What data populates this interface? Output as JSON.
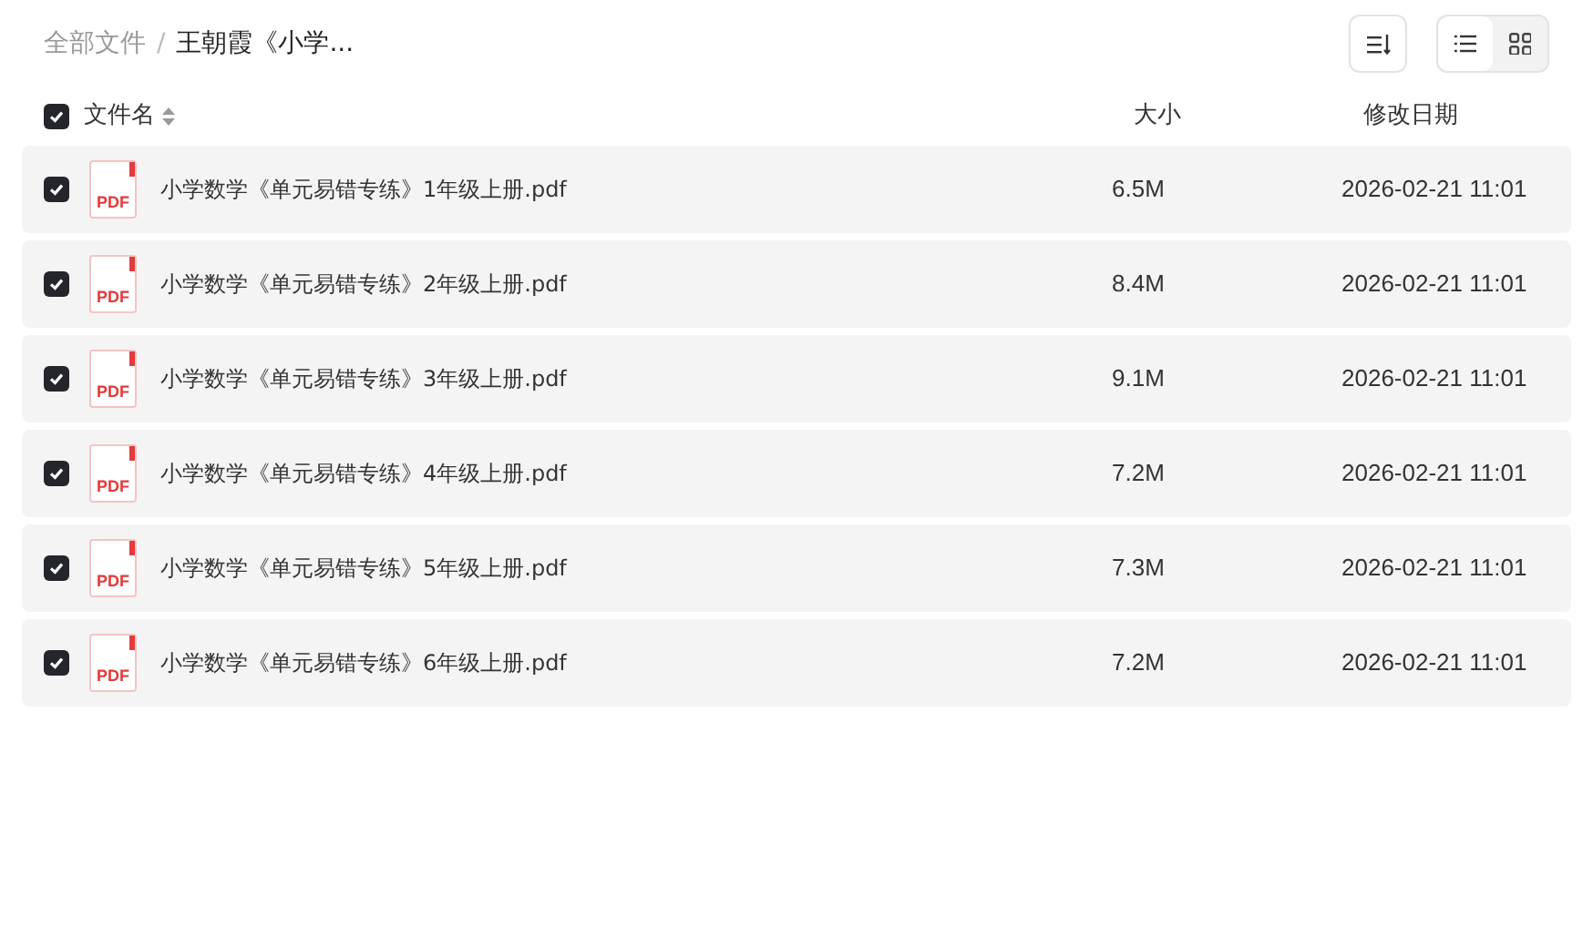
{
  "breadcrumb": [
    {
      "label": "全部文件",
      "current": false
    },
    {
      "label": "王朝霞《小学...",
      "current": true
    }
  ],
  "breadcrumb_separator": "/",
  "view_toggle": [
    {
      "kind": "list",
      "selected": true
    },
    {
      "kind": "grid",
      "selected": false
    }
  ],
  "table": {
    "select_all": {
      "checked": true
    },
    "columns": [
      "文件名",
      "大小",
      "修改日期"
    ],
    "rows": [
      {
        "checked": true,
        "file_type": "PDF",
        "name": "小学数学《单元易错专练》1年级上册.pdf",
        "size": "6.5M",
        "modified": "2026-02-21 11:01"
      },
      {
        "checked": true,
        "file_type": "PDF",
        "name": "小学数学《单元易错专练》2年级上册.pdf",
        "size": "8.4M",
        "modified": "2026-02-21 11:01"
      },
      {
        "checked": true,
        "file_type": "PDF",
        "name": "小学数学《单元易错专练》3年级上册.pdf",
        "size": "9.1M",
        "modified": "2026-02-21 11:01"
      },
      {
        "checked": true,
        "file_type": "PDF",
        "name": "小学数学《单元易错专练》4年级上册.pdf",
        "size": "7.2M",
        "modified": "2026-02-21 11:01"
      },
      {
        "checked": true,
        "file_type": "PDF",
        "name": "小学数学《单元易错专练》5年级上册.pdf",
        "size": "7.3M",
        "modified": "2026-02-21 11:01"
      },
      {
        "checked": true,
        "file_type": "PDF",
        "name": "小学数学《单元易错专练》6年级上册.pdf",
        "size": "7.2M",
        "modified": "2026-02-21 11:01"
      }
    ]
  }
}
